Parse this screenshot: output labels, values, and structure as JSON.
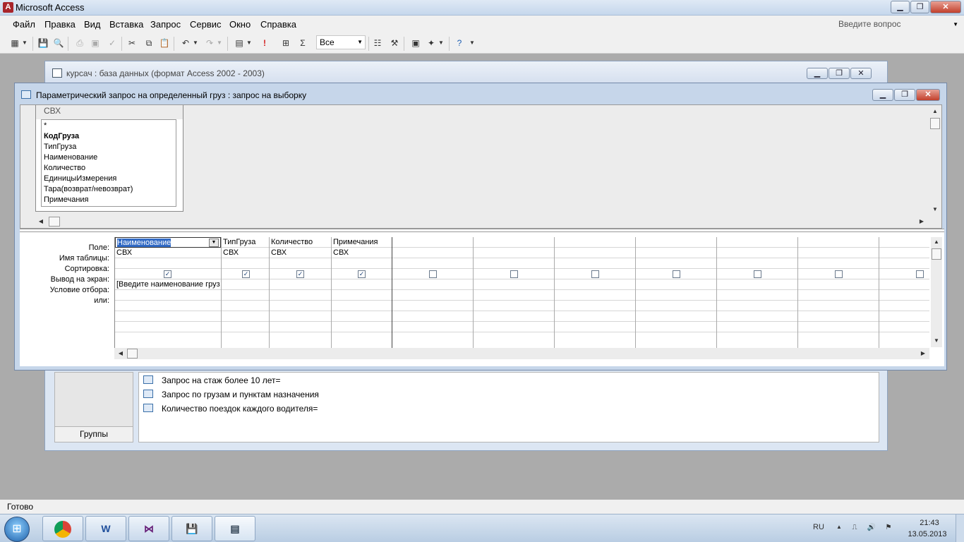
{
  "app": {
    "title": "Microsoft Access",
    "logo_letter": "A",
    "min_glyph": "▁",
    "max_glyph": "❐",
    "close_glyph": "✕"
  },
  "menu": {
    "items": [
      "Файл",
      "Правка",
      "Вид",
      "Вставка",
      "Запрос",
      "Сервис",
      "Окно",
      "Справка"
    ],
    "help_placeholder": "Введите вопрос"
  },
  "toolbar": {
    "top_values": "Все",
    "icons": [
      "view-icon",
      "save-icon",
      "print-preview-icon",
      "print-icon",
      "preview-icon",
      "spelling-icon",
      "cut-icon",
      "copy-icon",
      "paste-icon",
      "undo-icon",
      "redo-icon",
      "query-type-icon",
      "run-icon",
      "show-table-icon",
      "totals-icon",
      "properties-icon",
      "build-icon",
      "database-window-icon",
      "new-object-icon",
      "help-icon"
    ]
  },
  "db_window": {
    "title": "курсач : база данных (формат Access 2002 - 2003)",
    "groups_label": "Группы",
    "queries": [
      "Запрос на стаж более 10 лет=",
      "Запрос по грузам и пунктам назначения",
      "Количество поездок каждого водителя="
    ]
  },
  "query_window": {
    "title": "Параметрический запрос на определенный груз : запрос на выборку",
    "table": {
      "name": "СВХ",
      "fields": [
        "*",
        "КодГруза",
        "ТипГруза",
        "Наименование",
        "Количество",
        "ЕдиницыИзмерения",
        "Тара(возврат/невозврат)",
        "Примечания"
      ],
      "primary_key": "КодГруза"
    },
    "grid": {
      "row_labels": [
        "Поле:",
        "Имя таблицы:",
        "Сортировка:",
        "Вывод на экран:",
        "Условие отбора:",
        "или:"
      ],
      "columns": [
        {
          "field": "Наименование",
          "table": "СВХ",
          "sort": "",
          "show": true,
          "criteria": "[Введите наименование груз"
        },
        {
          "field": "ТипГруза",
          "table": "СВХ",
          "sort": "",
          "show": true,
          "criteria": ""
        },
        {
          "field": "Количество",
          "table": "СВХ",
          "sort": "",
          "show": true,
          "criteria": ""
        },
        {
          "field": "Примечания",
          "table": "СВХ",
          "sort": "",
          "show": true,
          "criteria": ""
        },
        {
          "field": "",
          "table": "",
          "sort": "",
          "show": false,
          "criteria": ""
        },
        {
          "field": "",
          "table": "",
          "sort": "",
          "show": false,
          "criteria": ""
        },
        {
          "field": "",
          "table": "",
          "sort": "",
          "show": false,
          "criteria": ""
        },
        {
          "field": "",
          "table": "",
          "sort": "",
          "show": false,
          "criteria": ""
        },
        {
          "field": "",
          "table": "",
          "sort": "",
          "show": false,
          "criteria": ""
        },
        {
          "field": "",
          "table": "",
          "sort": "",
          "show": false,
          "criteria": ""
        },
        {
          "field": "",
          "table": "",
          "sort": "",
          "show": false,
          "criteria": ""
        }
      ]
    }
  },
  "status": {
    "text": "Готово"
  },
  "taskbar": {
    "apps": [
      "chrome",
      "word",
      "visual-studio",
      "save",
      "access"
    ],
    "language": "RU",
    "time": "21:43",
    "date": "13.05.2013"
  }
}
